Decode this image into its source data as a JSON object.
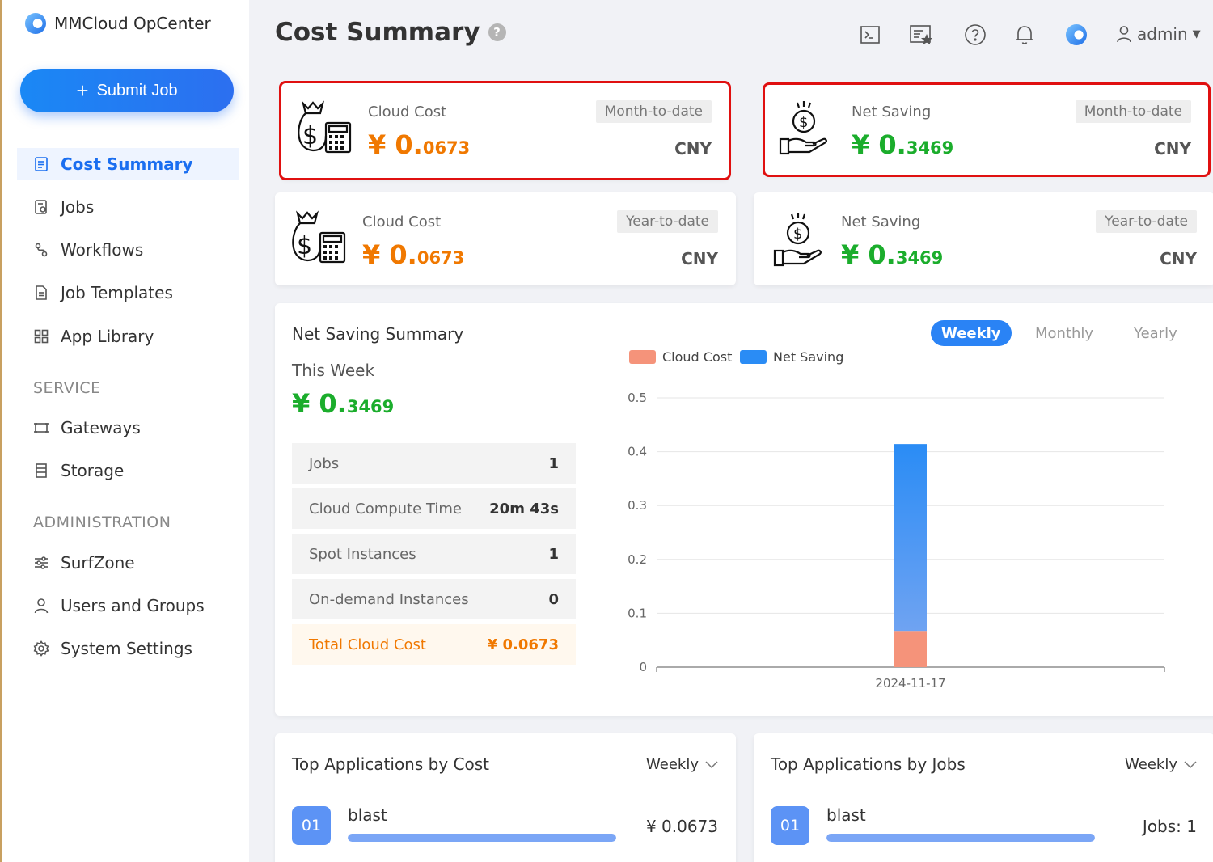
{
  "app": {
    "name": "MMCloud OpCenter"
  },
  "sidebar": {
    "submit_label": "Submit Job",
    "items": [
      {
        "label": "Cost Summary",
        "icon": "document-list-icon",
        "active": true
      },
      {
        "label": "Jobs",
        "icon": "job-file-icon"
      },
      {
        "label": "Workflows",
        "icon": "workflow-icon"
      },
      {
        "label": "Job Templates",
        "icon": "template-icon"
      },
      {
        "label": "App Library",
        "icon": "grid-icon"
      }
    ],
    "service_heading": "SERVICE",
    "service_items": [
      {
        "label": "Gateways",
        "icon": "gateway-icon"
      },
      {
        "label": "Storage",
        "icon": "storage-icon"
      }
    ],
    "admin_heading": "ADMINISTRATION",
    "admin_items": [
      {
        "label": "SurfZone",
        "icon": "sliders-icon"
      },
      {
        "label": "Users and Groups",
        "icon": "user-icon"
      },
      {
        "label": "System Settings",
        "icon": "gear-icon"
      }
    ]
  },
  "header": {
    "title": "Cost Summary",
    "help": "?",
    "user": "admin"
  },
  "stat_cards": [
    {
      "label": "Cloud Cost",
      "period": "Month-to-date",
      "symbol": "¥",
      "int": " 0.",
      "dec": "0673",
      "currency": "CNY",
      "highlighted": true,
      "color": "#f07800"
    },
    {
      "label": "Net Saving",
      "period": "Month-to-date",
      "symbol": "¥",
      "int": " 0.",
      "dec": "3469",
      "currency": "CNY",
      "highlighted": true,
      "color": "#1bad2c"
    },
    {
      "label": "Cloud Cost",
      "period": "Year-to-date",
      "symbol": "¥",
      "int": " 0.",
      "dec": "0673",
      "currency": "CNY",
      "highlighted": false,
      "color": "#f07800"
    },
    {
      "label": "Net Saving",
      "period": "Year-to-date",
      "symbol": "¥",
      "int": " 0.",
      "dec": "3469",
      "currency": "CNY",
      "highlighted": false,
      "color": "#1bad2c"
    }
  ],
  "summary": {
    "title": "Net Saving Summary",
    "period_label": "This Week",
    "value_symbol": "¥",
    "value_int": " 0.",
    "value_dec": "3469",
    "tabs": [
      "Weekly",
      "Monthly",
      "Yearly"
    ],
    "active_tab": "Weekly",
    "rows": [
      {
        "label": "Jobs",
        "value": "1"
      },
      {
        "label": "Cloud Compute Time",
        "value": "20m 43s"
      },
      {
        "label": "Spot Instances",
        "value": "1"
      },
      {
        "label": "On-demand Instances",
        "value": "0"
      },
      {
        "label": "Total Cloud Cost",
        "value": "¥ 0.0673"
      }
    ]
  },
  "chart_data": {
    "type": "bar",
    "stacked": true,
    "categories": [
      "2024-11-17"
    ],
    "series": [
      {
        "name": "Cloud Cost",
        "values": [
          0.0673
        ],
        "color": "#f5937a"
      },
      {
        "name": "Net Saving",
        "values": [
          0.3469
        ],
        "color": "#2a8cf5"
      }
    ],
    "ylim": [
      0,
      0.5
    ],
    "yticks": [
      0,
      0.1,
      0.2,
      0.3,
      0.4,
      0.5
    ],
    "grid": true,
    "legend": "top-left"
  },
  "top_cost": {
    "title": "Top Applications by Cost",
    "period": "Weekly",
    "items": [
      {
        "rank": "01",
        "name": "blast",
        "value": "¥ 0.0673",
        "fraction": 1.0
      }
    ]
  },
  "top_jobs": {
    "title": "Top Applications by Jobs",
    "period": "Weekly",
    "items": [
      {
        "rank": "01",
        "name": "blast",
        "value": "Jobs: 1",
        "fraction": 1.0
      }
    ]
  }
}
